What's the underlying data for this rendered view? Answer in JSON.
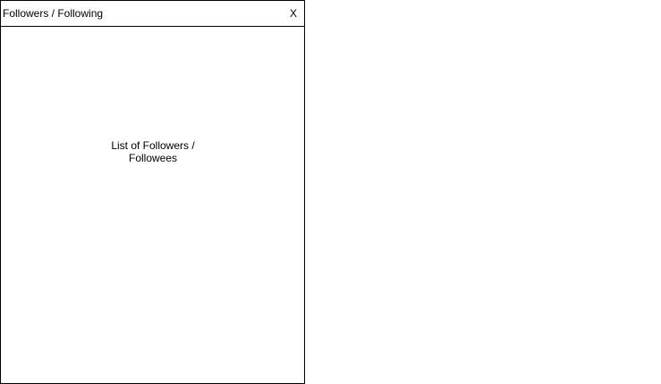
{
  "dialog": {
    "title": "Followers / Following",
    "close_label": "X"
  },
  "body": {
    "placeholder": "List of Followers / Followees"
  }
}
